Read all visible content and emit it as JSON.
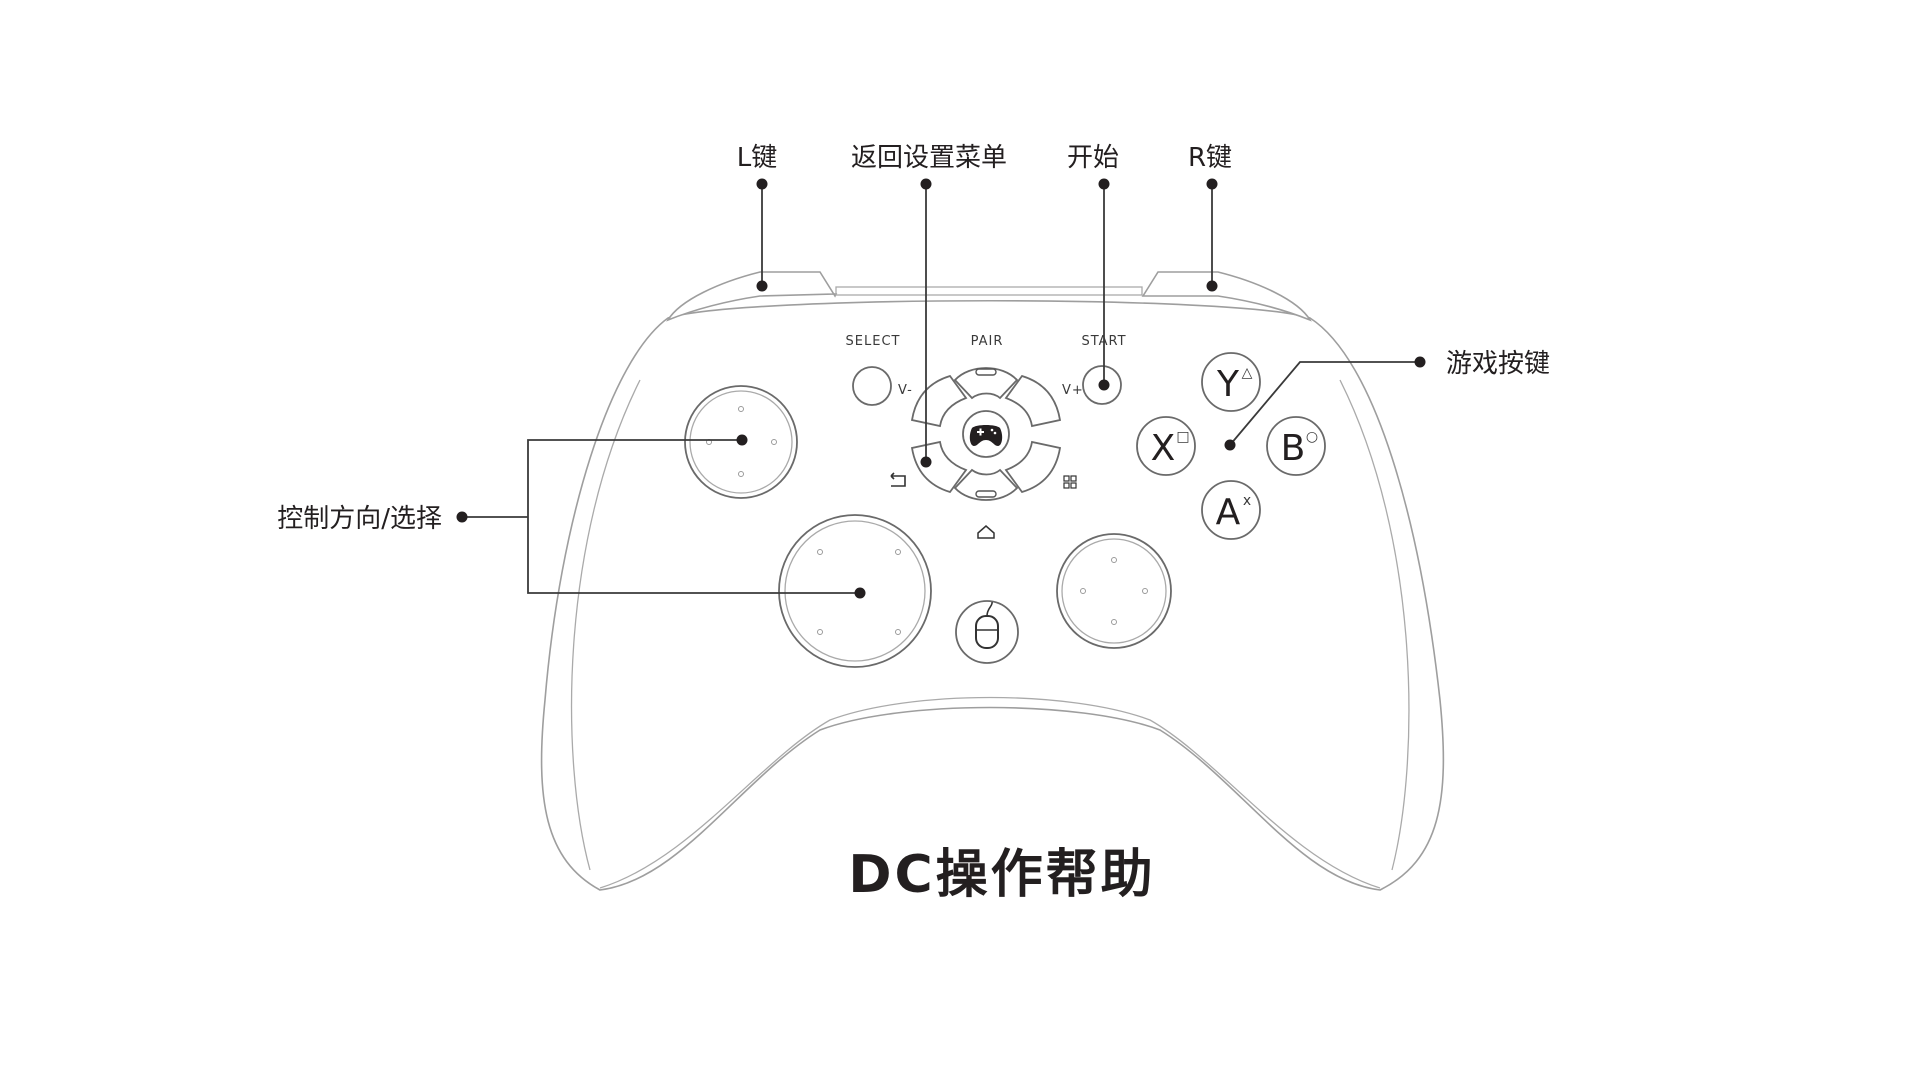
{
  "title": "DC操作帮助",
  "callouts": {
    "l_key": "L键",
    "back_menu": "返回设置菜单",
    "start": "开始",
    "r_key": "R键",
    "game_buttons": "游戏按键",
    "direction_select": "控制方向/选择"
  },
  "controller": {
    "select_label": "SELECT",
    "pair_label": "PAIR",
    "start_label": "START",
    "volume_down": "V-",
    "volume_up": "V+",
    "face_buttons": {
      "y": {
        "letter": "Y",
        "symbol": "△"
      },
      "x": {
        "letter": "X",
        "symbol": "□"
      },
      "b": {
        "letter": "B",
        "symbol": "○"
      },
      "a": {
        "letter": "A",
        "symbol": "x"
      }
    },
    "icons": [
      "gamepad-icon",
      "back-icon",
      "apps-icon",
      "home-icon",
      "mouse-icon"
    ]
  }
}
